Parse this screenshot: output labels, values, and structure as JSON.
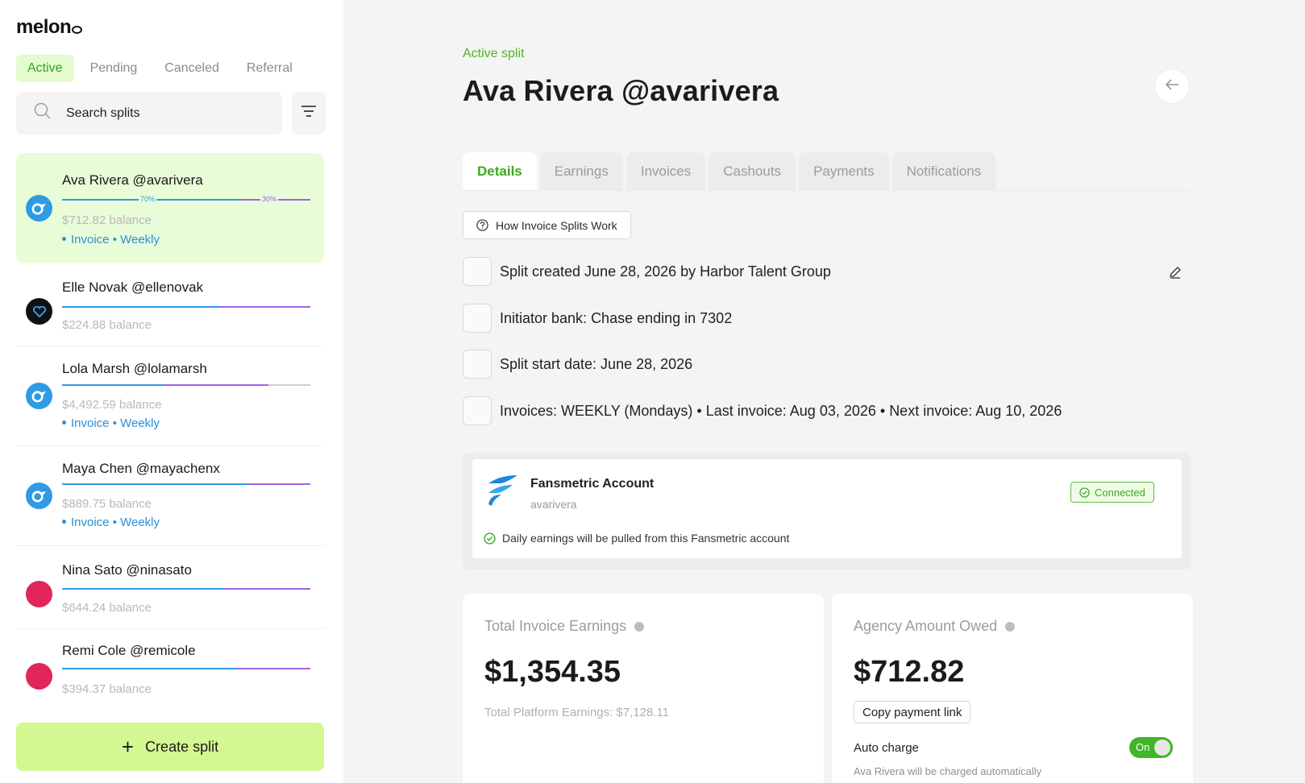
{
  "app": {
    "logo": "melon"
  },
  "sidebar": {
    "status_tabs": [
      "Active",
      "Pending",
      "Canceled",
      "Referral"
    ],
    "search_placeholder": "Search splits",
    "splits": [
      {
        "name": "Ava Rivera @avarivera",
        "balance": "$712.82 balance",
        "tags": "Invoice • Weekly",
        "label_a": "70%",
        "label_b": "30%",
        "avatar_color": "#2e9be4"
      },
      {
        "name": "Elle Novak @ellenovak",
        "balance": "$224.88 balance",
        "avatar_color": "#111111"
      },
      {
        "name": "Lola Marsh @lolamarsh",
        "balance": "$4,492.59 balance",
        "tags": "Invoice • Weekly",
        "avatar_color": "#2e9be4"
      },
      {
        "name": "Maya Chen @mayachenx",
        "balance": "$889.75 balance",
        "tags": "Invoice • Weekly",
        "avatar_color": "#2e9be4"
      },
      {
        "name": "Nina Sato @ninasato",
        "balance": "$644.24 balance",
        "avatar_color": "#e0265a"
      },
      {
        "name": "Remi Cole @remicole",
        "balance": "$394.37 balance",
        "avatar_color": "#e0265a"
      }
    ],
    "create_label": "Create split"
  },
  "main": {
    "eyebrow": "Active split",
    "title": "Ava Rivera @avarivera",
    "tabs": [
      "Details",
      "Earnings",
      "Invoices",
      "Cashouts",
      "Payments",
      "Notifications"
    ],
    "how_button": "How Invoice Splits Work",
    "details": [
      "Split created June 28, 2026 by Harbor Talent Group",
      "Initiator bank: Chase ending in 7302",
      "Split start date: June 28, 2026",
      "Invoices: WEEKLY (Mondays) • Last invoice: Aug 03, 2026 • Next invoice: Aug 10, 2026"
    ],
    "fansmetric": {
      "title": "Fansmetric Account",
      "username": "avarivera",
      "status": "Connected",
      "note": "Daily earnings will be pulled from this Fansmetric account"
    },
    "earnings_card": {
      "label": "Total Invoice Earnings",
      "value": "$1,354.35",
      "sub": "Total Platform Earnings: $7,128.11"
    },
    "owed_card": {
      "label": "Agency Amount Owed",
      "value": "$712.82",
      "copy_button": "Copy payment link",
      "auto_label": "Auto charge",
      "toggle": "On",
      "auto_desc": "Ava Rivera will be charged automatically"
    }
  },
  "colors": {
    "accent_green": "#3aa91f",
    "create_bg": "#d4f891",
    "selected_bg": "#e9fcd8",
    "bar_blue": "#2e9be4",
    "bar_purple": "#a560e8"
  }
}
